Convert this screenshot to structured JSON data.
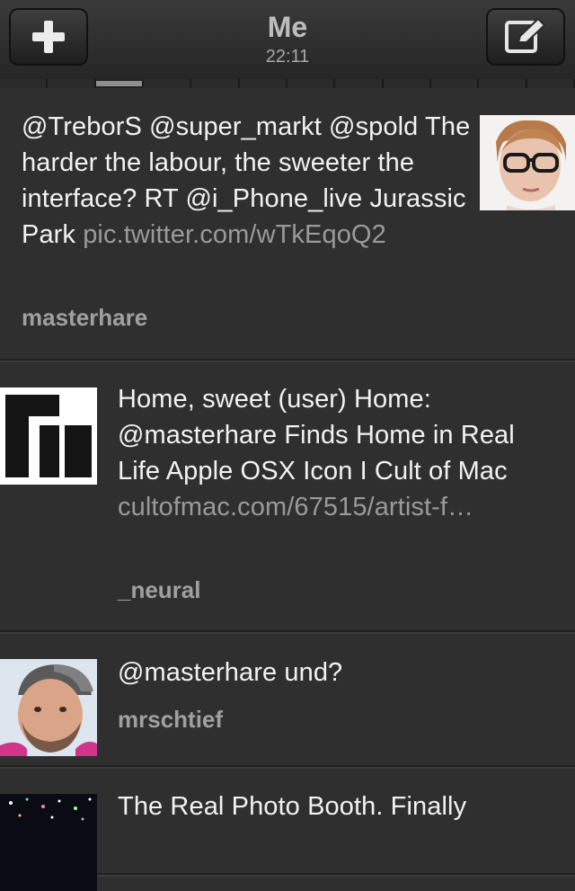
{
  "nav": {
    "title": "Me",
    "time": "22:11",
    "left_icon": "plus-icon",
    "right_icon": "compose-icon"
  },
  "pager": {
    "segments": 12,
    "active_index": 2
  },
  "tweets": [
    {
      "text": "@TreborS @super_markt @spold The harder the labour, the sweeter the interface? RT @i_Phone_live Jurassic Park",
      "link": "pic.twitter.com/wTkEqoQ2",
      "author": "masterhare",
      "avatar": "person-with-glasses"
    },
    {
      "text": "Home, sweet (user) Home: @masterhare Finds Home in Real Life Apple OSX Icon I Cult of Mac",
      "link": "cultofmac.com/67515/artist-f…",
      "author": "_neural",
      "avatar": "black-blocks-logo"
    },
    {
      "text": "@masterhare und?",
      "link": "",
      "author": "mrschtief",
      "avatar": "bearded-man-cap"
    },
    {
      "text": "The Real Photo Booth. Finally",
      "link": "",
      "author": "",
      "avatar": "starry-sparkles"
    }
  ]
}
